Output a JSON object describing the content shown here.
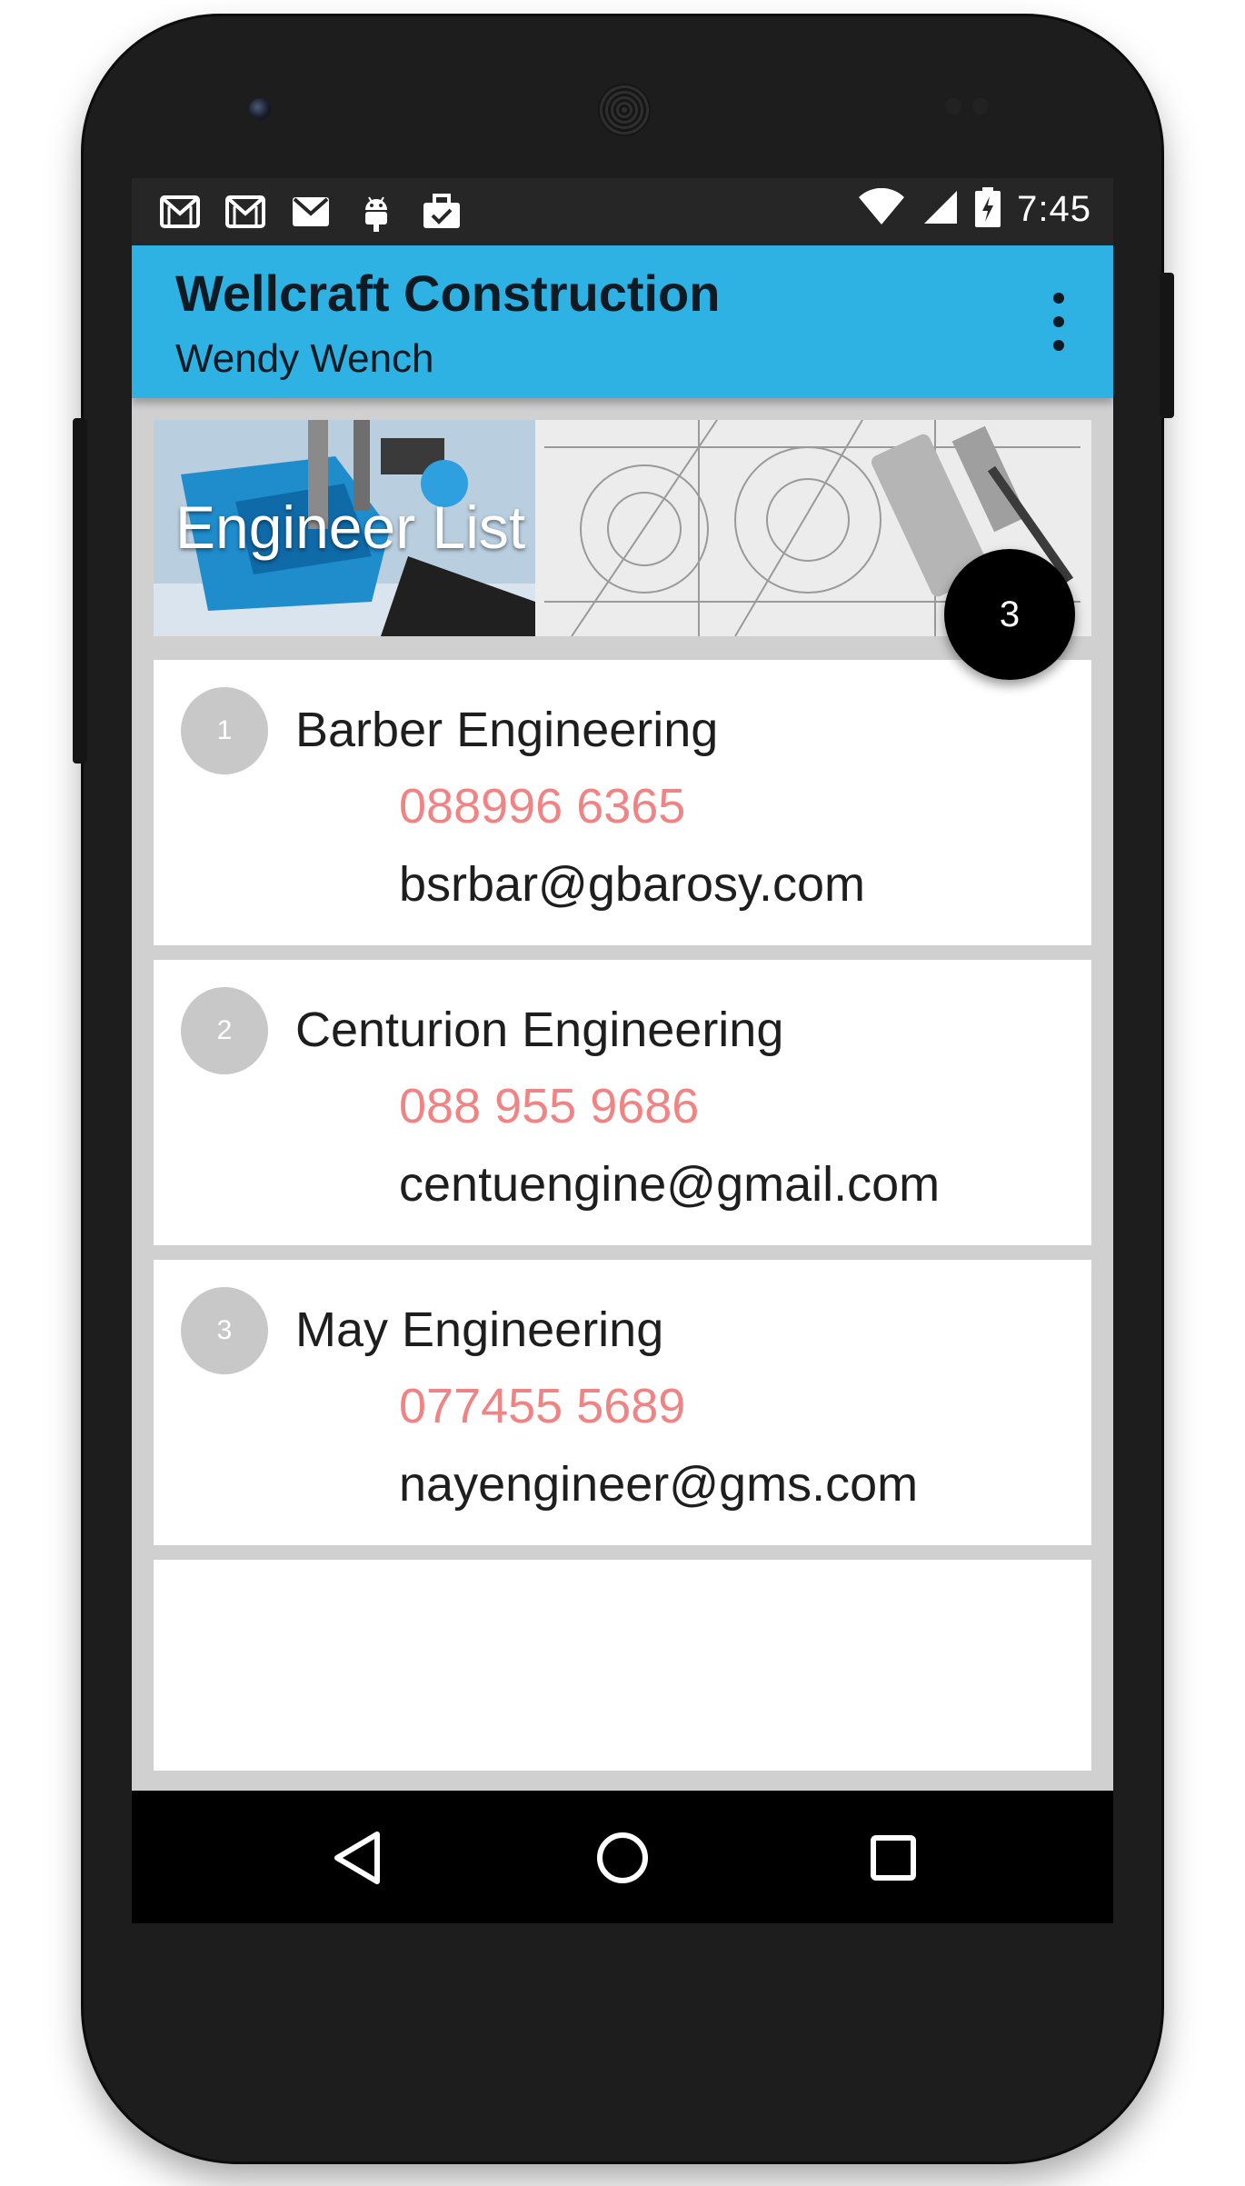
{
  "status_bar": {
    "time": "7:45",
    "notification_icons": [
      "gmail-icon",
      "gmail-icon",
      "gmail-icon",
      "android-icon",
      "briefcase-check-icon"
    ],
    "system_icons": [
      "wifi-icon",
      "cell-signal-icon",
      "battery-charging-icon"
    ]
  },
  "app_bar": {
    "title": "Wellcraft Construction",
    "subtitle": "Wendy Wench",
    "menu_icon": "overflow-menu-icon",
    "background_color": "#2eb2e4"
  },
  "banner": {
    "title": "Engineer List"
  },
  "fab": {
    "label": "3"
  },
  "engineers": [
    {
      "index": "1",
      "name": "Barber Engineering",
      "phone": "088996 6365",
      "email": "bsrbar@gbarosy.com"
    },
    {
      "index": "2",
      "name": "Centurion Engineering",
      "phone": "088 955 9686",
      "email": "centuengine@gmail.com"
    },
    {
      "index": "3",
      "name": "May Engineering",
      "phone": "077455 5689",
      "email": "nayengineer@gms.com"
    }
  ],
  "colors": {
    "phone_text": "#f08484",
    "avatar": "#c8c8c8",
    "fab": "#000000"
  },
  "nav_bar": {
    "buttons": [
      "back-icon",
      "home-icon",
      "recents-icon"
    ]
  }
}
